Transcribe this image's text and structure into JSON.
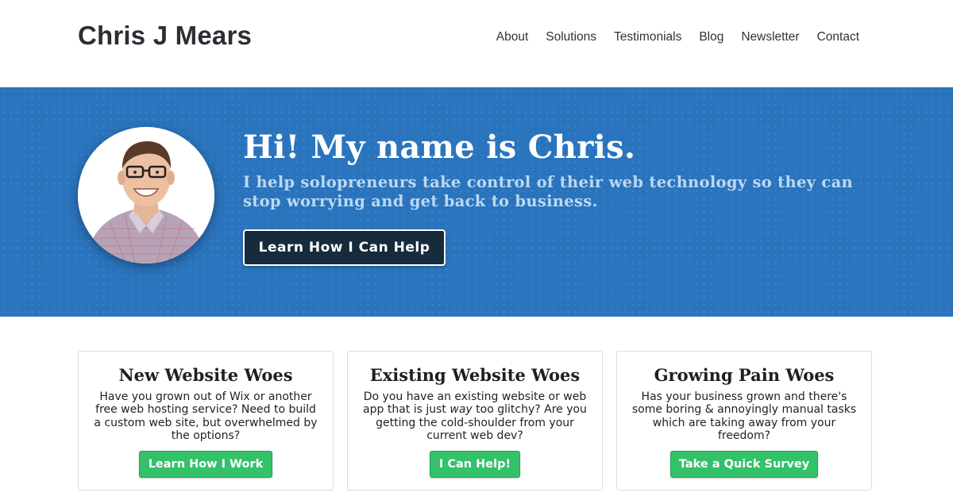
{
  "header": {
    "site_title": "Chris J Mears",
    "nav": [
      "About",
      "Solutions",
      "Testimonials",
      "Blog",
      "Newsletter",
      "Contact"
    ]
  },
  "hero": {
    "heading": "Hi! My name is Chris.",
    "subheading": "I help solopreneurs take control of their web technology so they can stop worrying and get back to business.",
    "cta_label": "Learn How I Can Help",
    "avatar_icon": "portrait-photo"
  },
  "cards": [
    {
      "title": "New Website Woes",
      "text": "Have you grown out of Wix or another free web hosting service? Need to build a custom web site, but overwhelmed by the options?",
      "button": "Learn How I Work"
    },
    {
      "title": "Existing Website Woes",
      "text_before": "Do you have an existing website or web app that is just ",
      "text_em": "way",
      "text_after": " too glitchy? Are you getting the cold-shoulder from your current web dev?",
      "button": "I Can Help!"
    },
    {
      "title": "Growing Pain Woes",
      "text": "Has your business grown and there's some boring & annoyingly manual tasks which are taking away from your freedom?",
      "button": "Take a Quick Survey"
    }
  ],
  "colors": {
    "hero_bg": "#2a74bd",
    "hero_sub": "#bcd8f3",
    "cta_bg": "#172b3d",
    "card_button": "#33c16a"
  }
}
